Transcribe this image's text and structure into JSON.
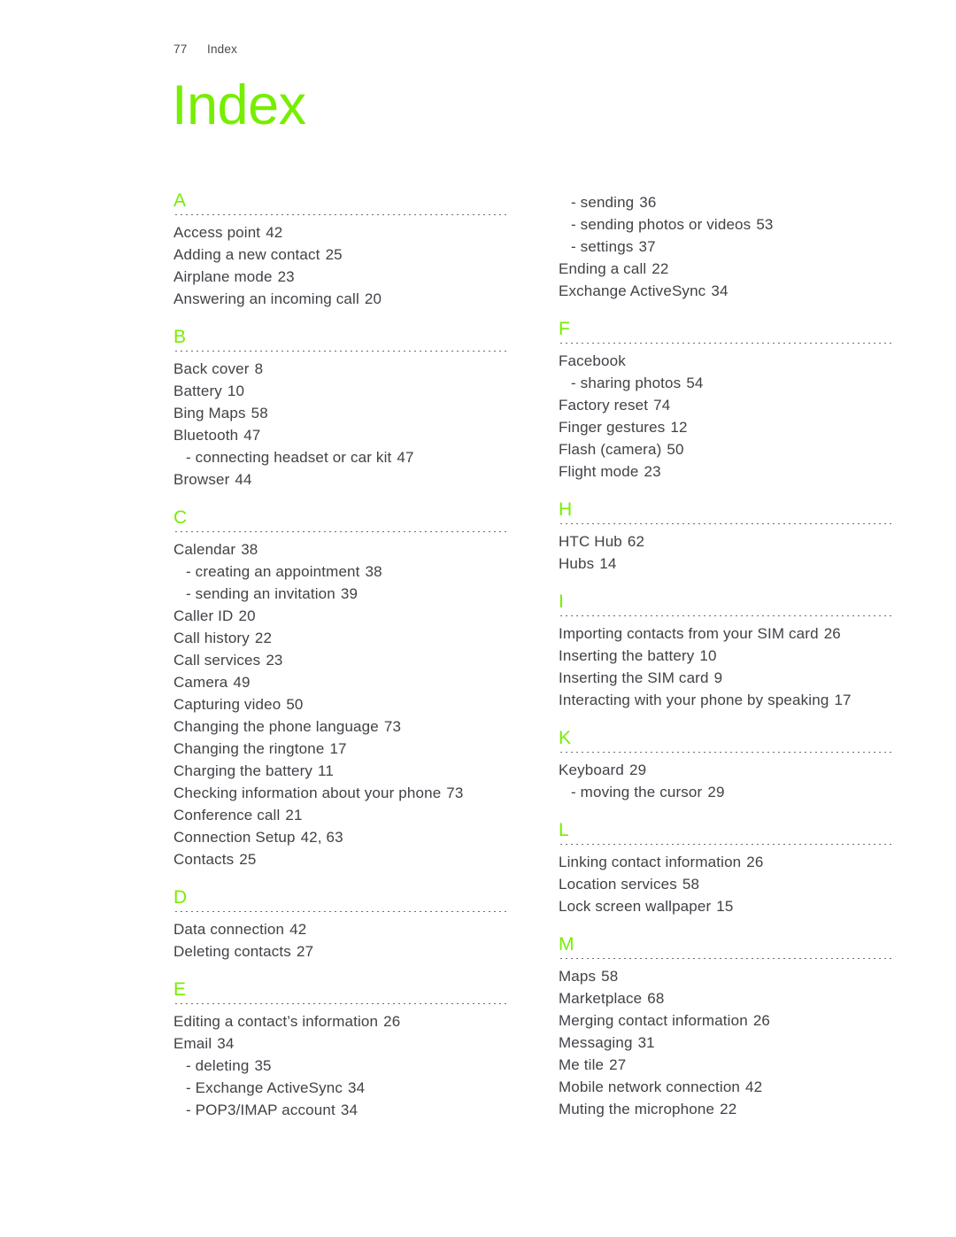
{
  "page": {
    "folio": "77",
    "running_head": "Index",
    "title": "Index",
    "accent_color": "#76ee00",
    "text_color": "#404247"
  },
  "columns": [
    {
      "blocks": [
        {
          "type": "section",
          "letter": "A",
          "entries": [
            {
              "text": "Access point",
              "page": "42",
              "sub": false
            },
            {
              "text": "Adding a new contact",
              "page": "25",
              "sub": false
            },
            {
              "text": "Airplane mode",
              "page": "23",
              "sub": false
            },
            {
              "text": "Answering an incoming call",
              "page": "20",
              "sub": false
            }
          ]
        },
        {
          "type": "section",
          "letter": "B",
          "entries": [
            {
              "text": "Back cover",
              "page": "8",
              "sub": false
            },
            {
              "text": "Battery",
              "page": "10",
              "sub": false
            },
            {
              "text": "Bing Maps",
              "page": "58",
              "sub": false
            },
            {
              "text": "Bluetooth",
              "page": "47",
              "sub": false
            },
            {
              "text": "- connecting headset or car kit",
              "page": "47",
              "sub": true
            },
            {
              "text": "Browser",
              "page": "44",
              "sub": false
            }
          ]
        },
        {
          "type": "section",
          "letter": "C",
          "entries": [
            {
              "text": "Calendar",
              "page": "38",
              "sub": false
            },
            {
              "text": "- creating an appointment",
              "page": "38",
              "sub": true
            },
            {
              "text": "- sending an invitation",
              "page": "39",
              "sub": true
            },
            {
              "text": "Caller ID",
              "page": "20",
              "sub": false
            },
            {
              "text": "Call history",
              "page": "22",
              "sub": false
            },
            {
              "text": "Call services",
              "page": "23",
              "sub": false
            },
            {
              "text": "Camera",
              "page": "49",
              "sub": false
            },
            {
              "text": "Capturing video",
              "page": "50",
              "sub": false
            },
            {
              "text": "Changing the phone language",
              "page": "73",
              "sub": false
            },
            {
              "text": "Changing the ringtone",
              "page": "17",
              "sub": false
            },
            {
              "text": "Charging the battery",
              "page": "11",
              "sub": false
            },
            {
              "text": "Checking information about your phone",
              "page": "73",
              "sub": false
            },
            {
              "text": "Conference call",
              "page": "21",
              "sub": false
            },
            {
              "text": "Connection Setup",
              "page": "42, 63",
              "sub": false
            },
            {
              "text": "Contacts",
              "page": "25",
              "sub": false
            }
          ]
        },
        {
          "type": "section",
          "letter": "D",
          "entries": [
            {
              "text": "Data connection",
              "page": "42",
              "sub": false
            },
            {
              "text": "Deleting contacts",
              "page": "27",
              "sub": false
            }
          ]
        },
        {
          "type": "section",
          "letter": "E",
          "entries": [
            {
              "text": "Editing a contact’s information",
              "page": "26",
              "sub": false
            },
            {
              "text": "Email",
              "page": "34",
              "sub": false
            },
            {
              "text": "- deleting",
              "page": "35",
              "sub": true
            },
            {
              "text": "- Exchange ActiveSync",
              "page": "34",
              "sub": true
            },
            {
              "text": "- POP3/IMAP account",
              "page": "34",
              "sub": true
            }
          ]
        }
      ]
    },
    {
      "blocks": [
        {
          "type": "continuation",
          "letter": "",
          "entries": [
            {
              "text": "- sending",
              "page": "36",
              "sub": true
            },
            {
              "text": "- sending photos or videos",
              "page": "53",
              "sub": true
            },
            {
              "text": "- settings",
              "page": "37",
              "sub": true
            },
            {
              "text": "Ending a call",
              "page": "22",
              "sub": false
            },
            {
              "text": "Exchange ActiveSync",
              "page": "34",
              "sub": false
            }
          ]
        },
        {
          "type": "section",
          "letter": "F",
          "entries": [
            {
              "text": "Facebook",
              "page": "",
              "sub": false
            },
            {
              "text": "- sharing photos",
              "page": "54",
              "sub": true
            },
            {
              "text": "Factory reset",
              "page": "74",
              "sub": false
            },
            {
              "text": "Finger gestures",
              "page": "12",
              "sub": false
            },
            {
              "text": "Flash (camera)",
              "page": "50",
              "sub": false
            },
            {
              "text": "Flight mode",
              "page": "23",
              "sub": false
            }
          ]
        },
        {
          "type": "section",
          "letter": "H",
          "entries": [
            {
              "text": "HTC Hub",
              "page": "62",
              "sub": false
            },
            {
              "text": "Hubs",
              "page": "14",
              "sub": false
            }
          ]
        },
        {
          "type": "section",
          "letter": "I",
          "entries": [
            {
              "text": "Importing contacts from your SIM card",
              "page": "26",
              "sub": false
            },
            {
              "text": "Inserting the battery",
              "page": "10",
              "sub": false
            },
            {
              "text": "Inserting the SIM card",
              "page": "9",
              "sub": false
            },
            {
              "text": "Interacting with your phone by speaking",
              "page": "17",
              "sub": false
            }
          ]
        },
        {
          "type": "section",
          "letter": "K",
          "entries": [
            {
              "text": "Keyboard",
              "page": "29",
              "sub": false
            },
            {
              "text": "- moving the cursor",
              "page": "29",
              "sub": true
            }
          ]
        },
        {
          "type": "section",
          "letter": "L",
          "entries": [
            {
              "text": "Linking contact information",
              "page": "26",
              "sub": false
            },
            {
              "text": "Location services",
              "page": "58",
              "sub": false
            },
            {
              "text": "Lock screen wallpaper",
              "page": "15",
              "sub": false
            }
          ]
        },
        {
          "type": "section",
          "letter": "M",
          "entries": [
            {
              "text": "Maps",
              "page": "58",
              "sub": false
            },
            {
              "text": "Marketplace",
              "page": "68",
              "sub": false
            },
            {
              "text": "Merging contact information",
              "page": "26",
              "sub": false
            },
            {
              "text": "Messaging",
              "page": "31",
              "sub": false
            },
            {
              "text": "Me tile",
              "page": "27",
              "sub": false
            },
            {
              "text": "Mobile network connection",
              "page": "42",
              "sub": false
            },
            {
              "text": "Muting the microphone",
              "page": "22",
              "sub": false
            }
          ]
        }
      ]
    }
  ]
}
